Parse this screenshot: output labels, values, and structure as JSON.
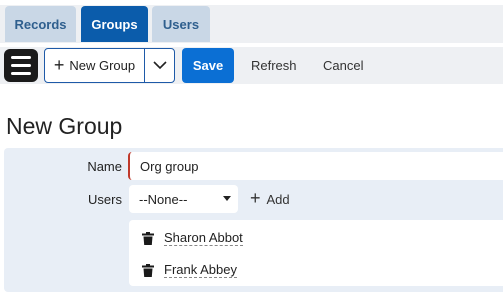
{
  "tabs": [
    {
      "label": "Records",
      "active": false
    },
    {
      "label": "Groups",
      "active": true
    },
    {
      "label": "Users",
      "active": false
    }
  ],
  "toolbar": {
    "menu_icon": "hamburger-menu-icon",
    "new_button_label": "New Group",
    "new_button_icon": "plus-icon",
    "dropdown_icon": "chevron-down-icon",
    "save_label": "Save",
    "refresh_label": "Refresh",
    "cancel_label": "Cancel"
  },
  "page": {
    "title": "New Group"
  },
  "form": {
    "name_label": "Name",
    "name_value": "Org group",
    "users_label": "Users",
    "users_select_value": "--None--",
    "add_label": "Add",
    "members": [
      "Sharon Abbot",
      "Frank Abbey"
    ]
  },
  "colors": {
    "primary": "#0b6fd4",
    "active_tab": "#0b5cab",
    "inactive_tab": "#c9d7e6",
    "panel": "#e8eef6",
    "required_marker": "#c0392b"
  }
}
